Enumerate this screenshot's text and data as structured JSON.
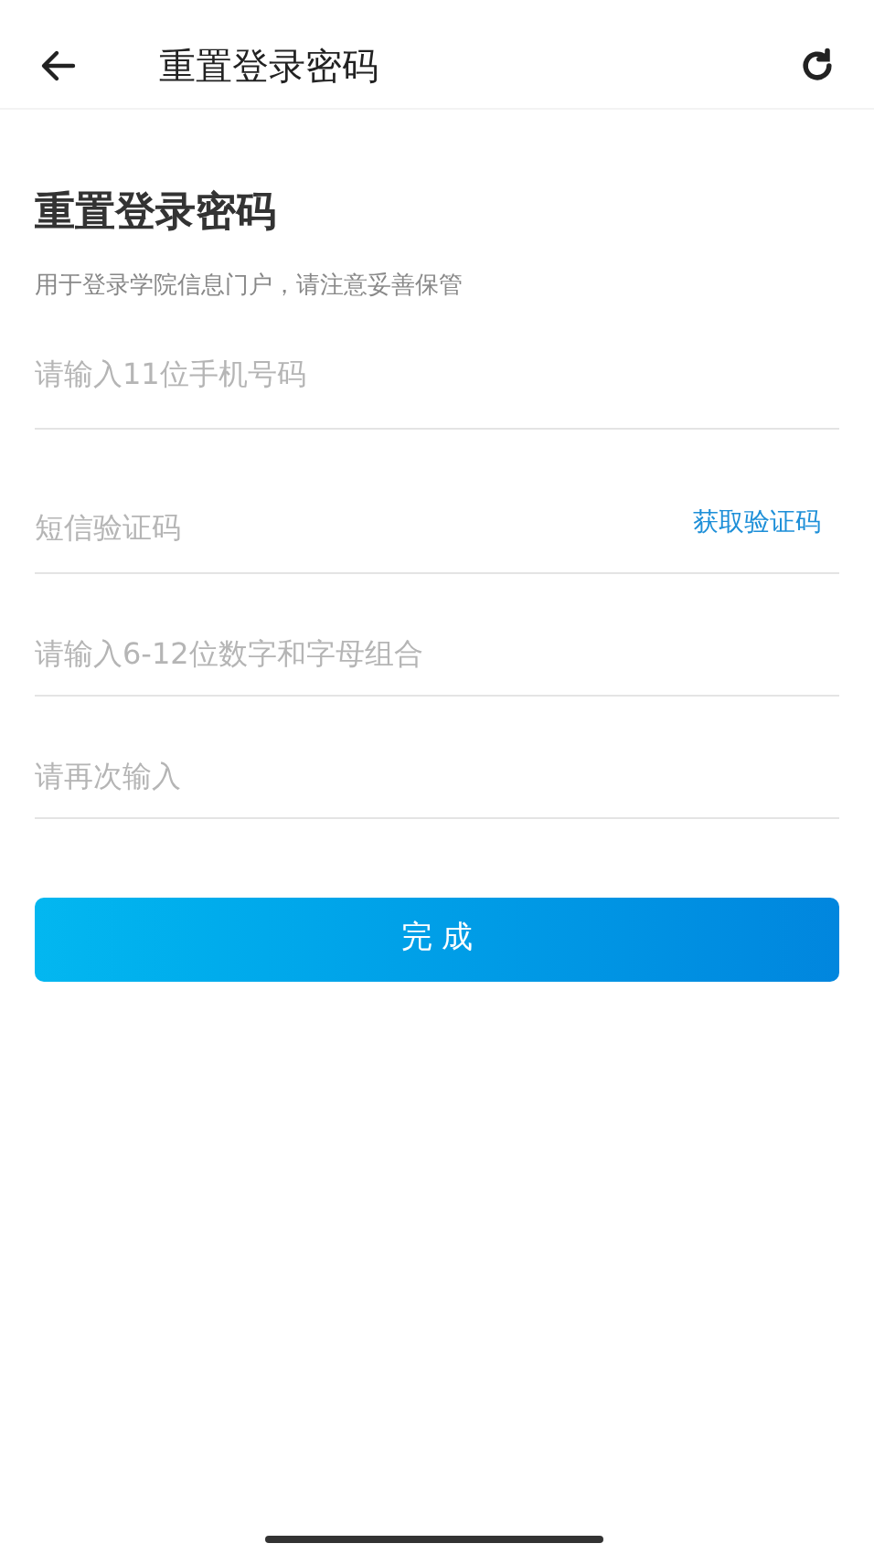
{
  "header": {
    "title": "重置登录密码"
  },
  "heading": "重置登录密码",
  "subtitle": "用于登录学院信息门户，请注意妥善保管",
  "fields": [
    {
      "kind": "plain",
      "placeholder": "请输入11位手机号码"
    },
    {
      "kind": "code",
      "placeholder": "短信验证码",
      "action": "获取验证码"
    },
    {
      "kind": "plain",
      "placeholder": "请输入6-12位数字和字母组合"
    },
    {
      "kind": "plain",
      "placeholder": "请再次输入"
    }
  ],
  "submit": "完 成"
}
